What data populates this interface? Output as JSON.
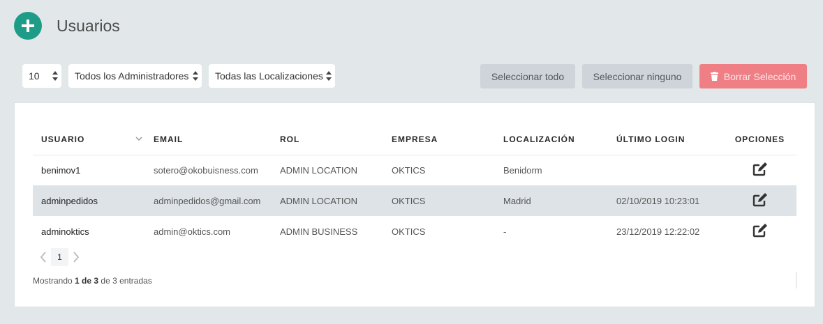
{
  "header": {
    "title": "Usuarios",
    "add_icon": "plus-icon",
    "accent": "#1f9c87"
  },
  "filters": {
    "page_size": "10",
    "administrators": "Todos los Administradores",
    "locations": "Todas las Localizaciones"
  },
  "actions": {
    "select_all": "Seleccionar todo",
    "select_none": "Seleccionar ninguno",
    "delete_selection": "Borrar Selección",
    "delete_icon": "trash-icon",
    "delete_color": "#ef7e85"
  },
  "table": {
    "columns": [
      "USUARIO",
      "EMAIL",
      "ROL",
      "EMPRESA",
      "LOCALIZACIÓN",
      "ÚLTIMO LOGIN",
      "OPCIONES"
    ],
    "rows": [
      {
        "usuario": "benimov1",
        "email": "sotero@okobuisness.com",
        "rol": "ADMIN LOCATION",
        "empresa": "OKTICS",
        "localizacion": "Benidorm",
        "ultimo_login": ""
      },
      {
        "usuario": "adminpedidos",
        "email": "adminpedidos@gmail.com",
        "rol": "ADMIN LOCATION",
        "empresa": "OKTICS",
        "localizacion": "Madrid",
        "ultimo_login": "02/10/2019 10:23:01"
      },
      {
        "usuario": "adminoktics",
        "email": "admin@oktics.com",
        "rol": "ADMIN BUSINESS",
        "empresa": "OKTICS",
        "localizacion": "-",
        "ultimo_login": "23/12/2019 12:22:02"
      }
    ],
    "option_icon": "edit-icon"
  },
  "pagination": {
    "current_page": "1"
  },
  "info": {
    "prefix": "Mostrando",
    "range": "1 de 3",
    "suffix": "de 3 entradas"
  }
}
